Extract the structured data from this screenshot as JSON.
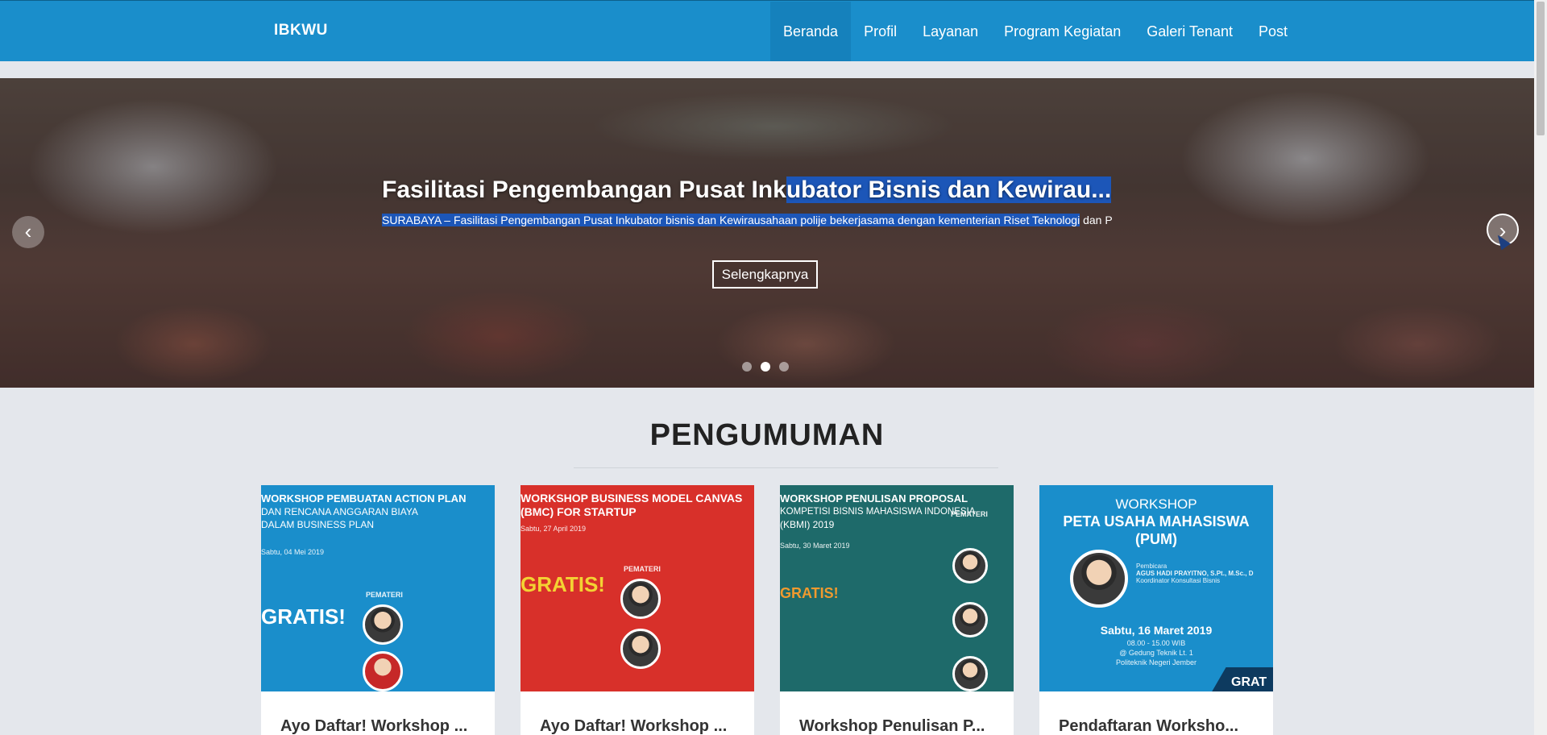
{
  "brand": "IBKWU",
  "nav": [
    {
      "label": "Beranda",
      "active": true
    },
    {
      "label": "Profil"
    },
    {
      "label": "Layanan"
    },
    {
      "label": "Program Kegiatan"
    },
    {
      "label": "Galeri Tenant"
    },
    {
      "label": "Post"
    }
  ],
  "hero": {
    "title_plain": "Fasilitasi Pengembangan Pusat Ink",
    "title_selected": "ubator Bisnis dan Kewirau...",
    "subtitle_selected": "SURABAYA – Fasilitasi Pengembangan Pusat Inkubator bisnis dan Kewirausahaan polije bekerjasama dengan kementerian Riset Teknologi",
    "subtitle_plain": " dan P",
    "button": "Selengkapnya",
    "prev_icon": "chevron-left-icon",
    "next_icon": "chevron-right-icon",
    "slides": 3,
    "active_slide": 2
  },
  "section": {
    "title": "PENGUMUMAN"
  },
  "cards": [
    {
      "title": "Ayo Daftar! Workshop ...",
      "poster": {
        "bg": "#1a8ecb",
        "line1": "WORKSHOP PEMBUATAN ACTION PLAN",
        "line2": "DAN RENCANA ANGGARAN BIAYA",
        "line3": "DALAM BUSINESS PLAN",
        "date": "Sabtu, 04 Mei 2019",
        "pemateri": "PEMATERI",
        "gratis": "GRATIS!"
      }
    },
    {
      "title": "Ayo Daftar! Workshop ...",
      "poster": {
        "bg": "#d8302a",
        "line1": "WORKSHOP BUSINESS MODEL CANVAS",
        "line2": "(BMC) FOR STARTUP",
        "date": "Sabtu, 27 April 2019",
        "pemateri": "PEMATERI",
        "gratis": "GRATIS!"
      }
    },
    {
      "title": "Workshop Penulisan P...",
      "poster": {
        "bg": "#1e6a6a",
        "line1": "WORKSHOP PENULISAN PROPOSAL",
        "line2": "KOMPETISI BISNIS MAHASISWA INDONESIA",
        "line3": "(KBMI) 2019",
        "date": "Sabtu, 30 Maret 2019",
        "pemateri": "PEMATERI",
        "gratis": "GRATIS!"
      }
    },
    {
      "title": "Pendaftaran Worksho...",
      "poster": {
        "bg": "#1a8ecb",
        "line1": "WORKSHOP",
        "line2": "PETA USAHA MAHASISWA",
        "line3": "(PUM)",
        "speaker_label": "Pembicara",
        "speaker": "AGUS HADI PRAYITNO, S.Pt., M.Sc., D",
        "role": "Koordinator Konsultasi Bisnis",
        "date": "Sabtu, 16 Maret 2019",
        "time": "08.00 - 15.00 WIB",
        "place": "@ Gedung Teknik Lt. 1",
        "place2": "Politeknik Negeri Jember",
        "gratis": "GRAT"
      }
    }
  ],
  "colors": {
    "navbar": "#1a8ecb",
    "nav_active": "#1581bc",
    "selection": "#1c56b8",
    "page_bg": "#e4e7ec"
  }
}
